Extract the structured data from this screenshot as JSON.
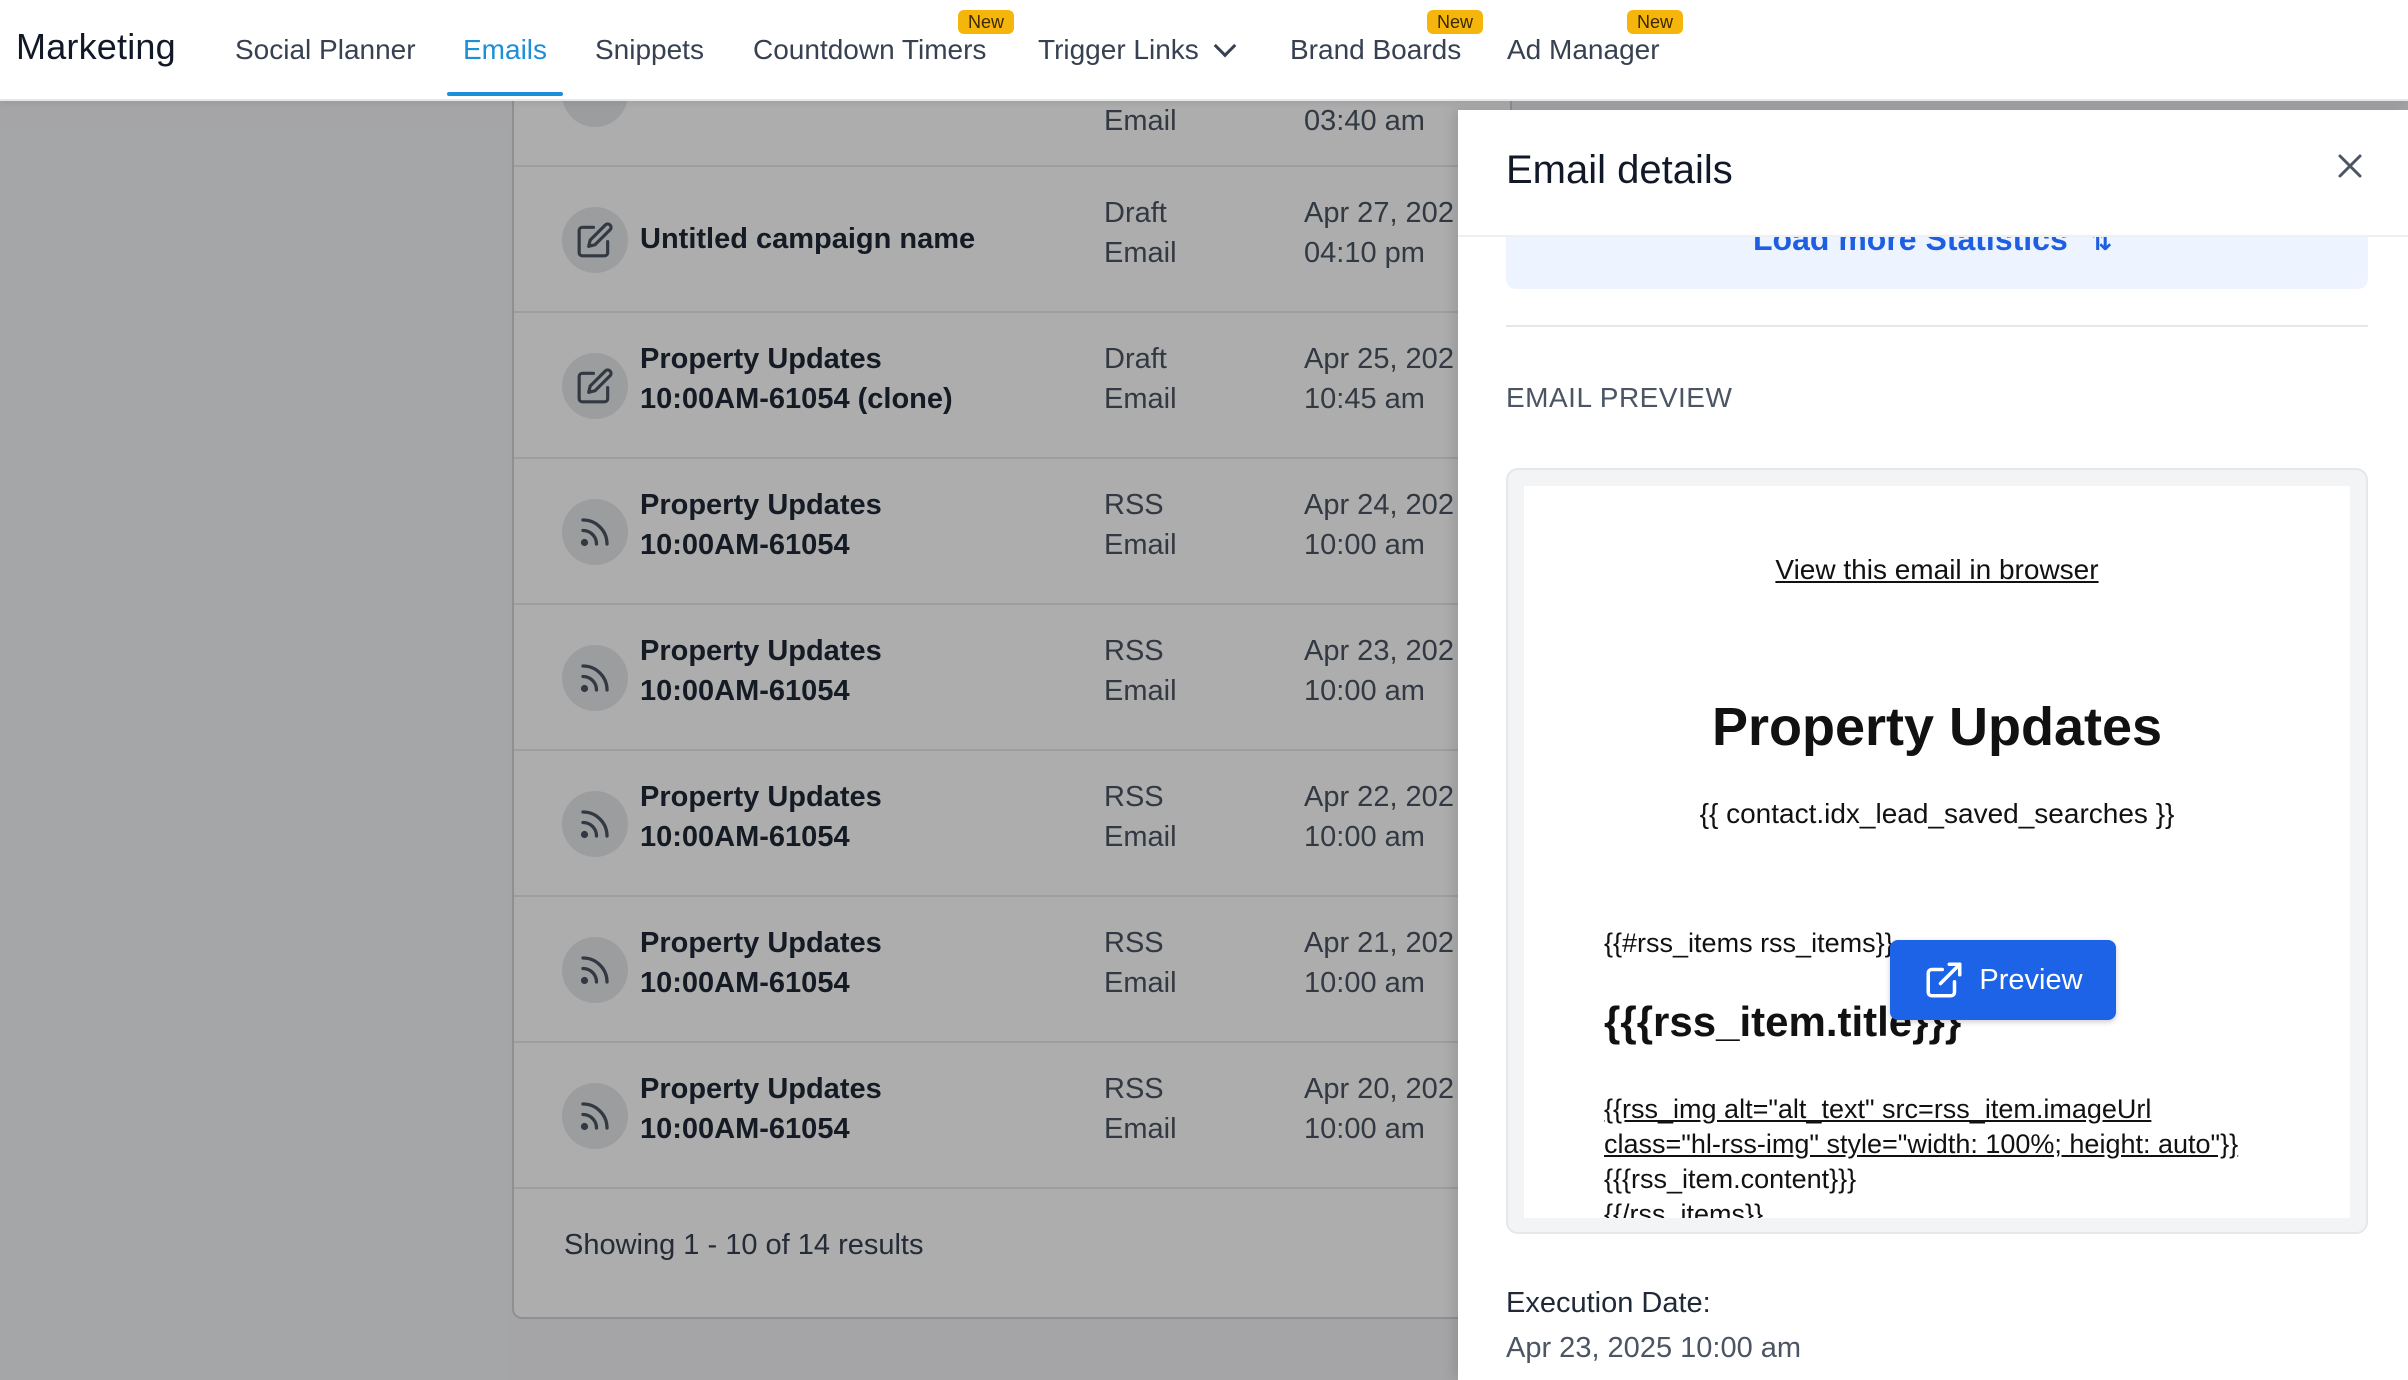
{
  "app": {
    "title": "Marketing"
  },
  "nav": {
    "items": [
      {
        "label": "Social Planner"
      },
      {
        "label": "Emails",
        "active": true
      },
      {
        "label": "Snippets"
      },
      {
        "label": "Countdown Timers",
        "badge": "New"
      },
      {
        "label": "Trigger Links",
        "dropdown": true
      },
      {
        "label": "Brand Boards",
        "badge": "New"
      },
      {
        "label": "Ad Manager",
        "badge": "New"
      }
    ],
    "active_color": "#1d8fd6",
    "badge_color": "#f5b50a"
  },
  "list": {
    "partial_top": {
      "type": "Email",
      "date": "03:40 am"
    },
    "rows": [
      {
        "icon": "edit-icon",
        "name1": "Untitled campaign name",
        "name2": "",
        "type1": "Draft",
        "type2": "Email",
        "date1": "Apr 27, 202",
        "date2": "04:10 pm"
      },
      {
        "icon": "edit-icon",
        "name1": "Property Updates",
        "name2": "10:00AM-61054 (clone)",
        "type1": "Draft",
        "type2": "Email",
        "date1": "Apr 25, 202",
        "date2": "10:45 am"
      },
      {
        "icon": "rss-icon",
        "name1": "Property Updates",
        "name2": "10:00AM-61054",
        "type1": "RSS",
        "type2": "Email",
        "date1": "Apr 24, 202",
        "date2": "10:00 am"
      },
      {
        "icon": "rss-icon",
        "name1": "Property Updates",
        "name2": "10:00AM-61054",
        "type1": "RSS",
        "type2": "Email",
        "date1": "Apr 23, 202",
        "date2": "10:00 am"
      },
      {
        "icon": "rss-icon",
        "name1": "Property Updates",
        "name2": "10:00AM-61054",
        "type1": "RSS",
        "type2": "Email",
        "date1": "Apr 22, 202",
        "date2": "10:00 am"
      },
      {
        "icon": "rss-icon",
        "name1": "Property Updates",
        "name2": "10:00AM-61054",
        "type1": "RSS",
        "type2": "Email",
        "date1": "Apr 21, 202",
        "date2": "10:00 am"
      },
      {
        "icon": "rss-icon",
        "name1": "Property Updates",
        "name2": "10:00AM-61054",
        "type1": "RSS",
        "type2": "Email",
        "date1": "Apr 20, 202",
        "date2": "10:00 am"
      }
    ],
    "showing": "Showing 1 - 10 of 14 results"
  },
  "drawer": {
    "title": "Email details",
    "load_more": "Load more Statistics",
    "section_label": "EMAIL PREVIEW",
    "preview": {
      "view_in_browser": "View this email in browser",
      "title": "Property Updates",
      "searches": "{{ contact.idx_lead_saved_searches }}",
      "rss_open": "{{#rss_items rss_items}}",
      "rss_title": "{{{rss_item.title}}}",
      "img_line1": "{{rss_img alt=\"alt_text\" src=rss_item.imageUrl",
      "img_line2": "class=\"hl-rss-img\" style=\"width: 100%; height: auto\"}}",
      "content_line": "{{{rss_item.content}}}",
      "rss_close": "{{/rss_items}}",
      "button_label": "Preview"
    },
    "execution_label": "Execution Date:",
    "execution_value": "Apr 23, 2025 10:00 am",
    "accent_color": "#1d63e8"
  }
}
